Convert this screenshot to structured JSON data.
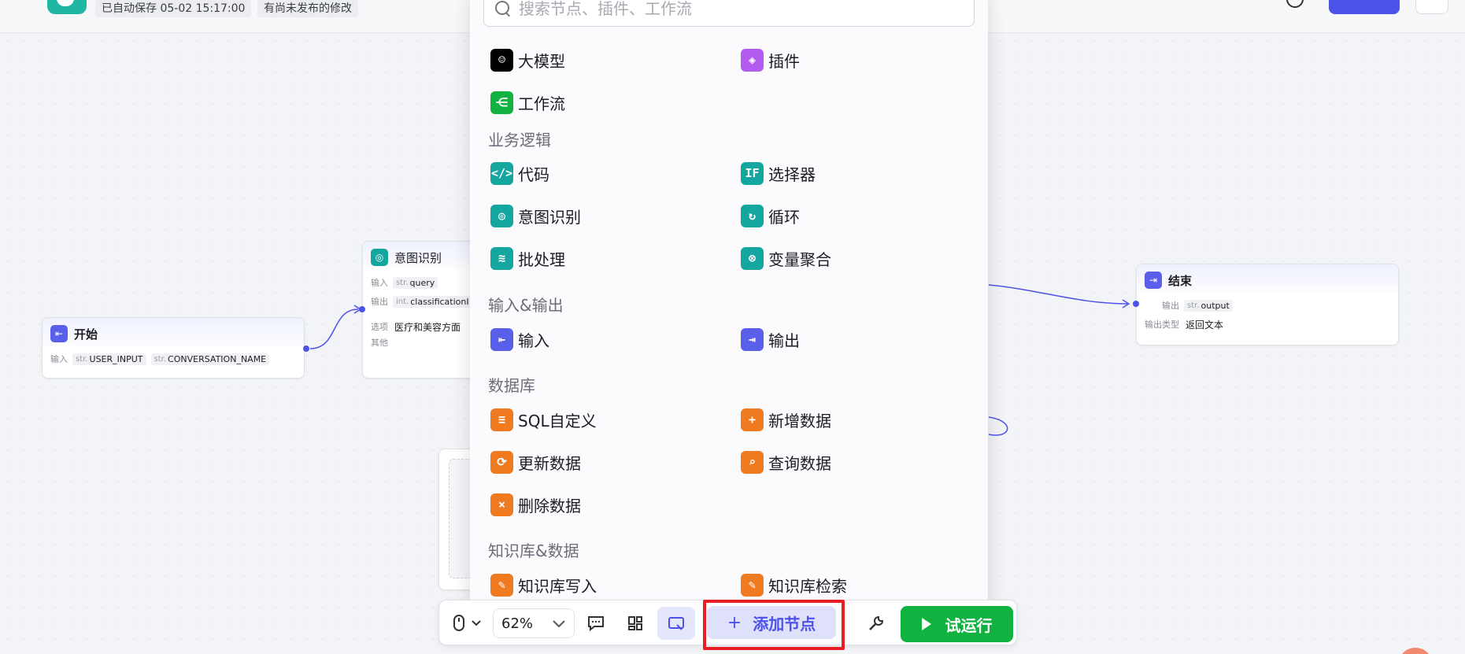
{
  "header": {
    "autosave": "已自动保存 05-02 15:17:00",
    "unpublished": "有尚未发布的修改"
  },
  "nodes": {
    "start": {
      "title": "开始",
      "input_label": "输入",
      "params": [
        {
          "type": "str.",
          "name": "USER_INPUT"
        },
        {
          "type": "str.",
          "name": "CONVERSATION_NAME"
        }
      ]
    },
    "intent": {
      "title": "意图识别",
      "input_label": "输入",
      "input_type": "str.",
      "input_name": "query",
      "output_label": "输出",
      "output_type": "int.",
      "output_name": "classificationI",
      "option_label": "选项",
      "option_value": "医疗和美容方面",
      "other_label": "其他"
    },
    "end": {
      "title": "结束",
      "output_label": "输出",
      "output_type": "str.",
      "output_name": "output",
      "output_type_label": "输出类型",
      "output_type_value": "返回文本"
    }
  },
  "panel": {
    "search_placeholder": "搜索节点、插件、工作流",
    "top_items": [
      {
        "label": "大模型",
        "icon": "llm-icon",
        "color": "#000000"
      },
      {
        "label": "插件",
        "icon": "plugin-icon",
        "color": "#b35cf0"
      },
      {
        "label": "工作流",
        "icon": "workflow-icon",
        "color": "#12b240"
      }
    ],
    "sections": [
      {
        "title": "业务逻辑",
        "items": [
          {
            "label": "代码",
            "icon": "code-icon",
            "color": "#16a6a0"
          },
          {
            "label": "选择器",
            "icon": "if-icon",
            "color": "#16a6a0"
          },
          {
            "label": "意图识别",
            "icon": "intent-icon",
            "color": "#16a6a0"
          },
          {
            "label": "循环",
            "icon": "loop-icon",
            "color": "#16a6a0"
          },
          {
            "label": "批处理",
            "icon": "batch-icon",
            "color": "#16a6a0"
          },
          {
            "label": "变量聚合",
            "icon": "variable-merge-icon",
            "color": "#16a6a0"
          }
        ]
      },
      {
        "title": "输入&输出",
        "items": [
          {
            "label": "输入",
            "icon": "input-icon",
            "color": "#5a5fe9"
          },
          {
            "label": "输出",
            "icon": "output-icon",
            "color": "#5a5fe9"
          }
        ]
      },
      {
        "title": "数据库",
        "items": [
          {
            "label": "SQL自定义",
            "icon": "sql-icon",
            "color": "#f07a1f"
          },
          {
            "label": "新增数据",
            "icon": "database-add-icon",
            "color": "#f07a1f"
          },
          {
            "label": "更新数据",
            "icon": "database-update-icon",
            "color": "#f07a1f"
          },
          {
            "label": "查询数据",
            "icon": "database-query-icon",
            "color": "#f07a1f"
          },
          {
            "label": "删除数据",
            "icon": "database-delete-icon",
            "color": "#f07a1f"
          }
        ]
      },
      {
        "title": "知识库&数据",
        "items": [
          {
            "label": "知识库写入",
            "icon": "knowledge-write-icon",
            "color": "#f07a1f"
          },
          {
            "label": "知识库检索",
            "icon": "knowledge-search-icon",
            "color": "#f07a1f"
          }
        ]
      }
    ]
  },
  "toolbar": {
    "zoom": "62%",
    "add_node": "添加节点",
    "run": "试运行",
    "accent": "#4d53e8",
    "run_color": "#12b240",
    "highlight_color": "#e81e25"
  }
}
